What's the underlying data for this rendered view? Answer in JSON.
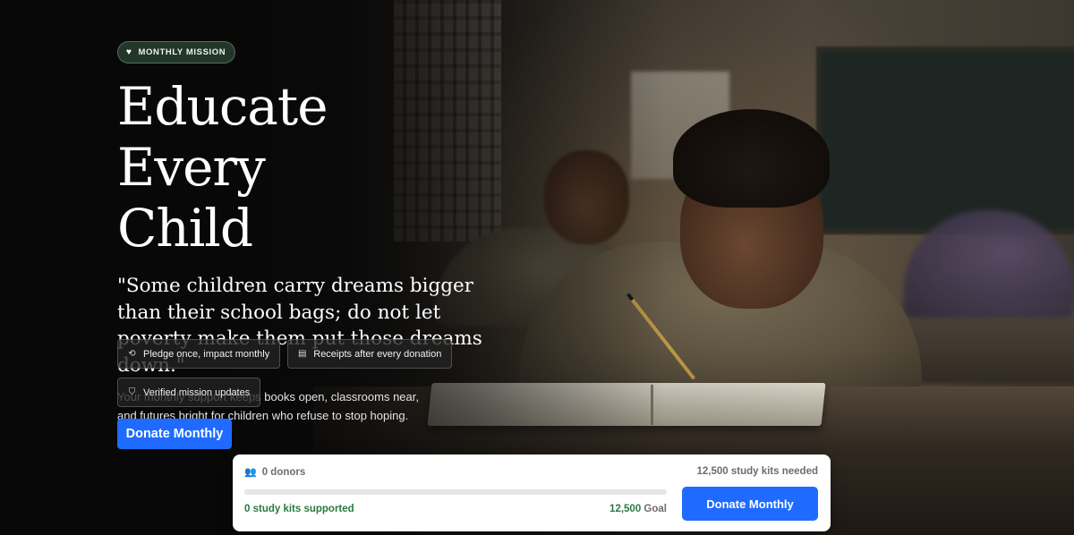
{
  "hero": {
    "badge_label": "MONTHLY MISSION",
    "title_line1": "Educate Every",
    "title_line2": "Child",
    "quote": "\"Some children carry dreams bigger than their school bags; do not let poverty make them put those dreams down.\"",
    "description": "Your monthly support keeps books open, classrooms near, and futures bright for children who refuse to stop hoping."
  },
  "features": [
    {
      "label": "Pledge once, impact monthly",
      "icon": "refresh-icon"
    },
    {
      "label": "Receipts after every donation",
      "icon": "receipt-icon"
    },
    {
      "label": "Verified mission updates",
      "icon": "shield-check-icon"
    }
  ],
  "cta": {
    "donate_label": "Donate Monthly"
  },
  "progress": {
    "donors_label": "0 donors",
    "needed_label": "12,500 study kits needed",
    "supported_label": "0 study kits supported",
    "goal_number": "12,500",
    "goal_suffix": " Goal",
    "fraction": 0,
    "donate_label": "Donate Monthly"
  },
  "colors": {
    "accent_blue": "#1f6bff",
    "success_green": "#2a7a42",
    "badge_green": "#2e4634"
  }
}
